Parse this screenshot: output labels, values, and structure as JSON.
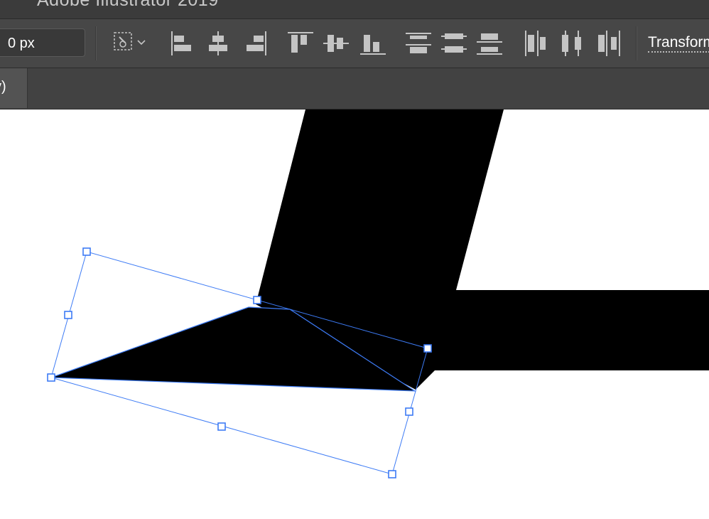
{
  "window": {
    "title": "Adobe Illustrator 2019"
  },
  "control_bar": {
    "stroke_field_value": "0 px",
    "transform_label": "Transform",
    "tools": [
      {
        "name": "select-same-icon"
      },
      {
        "name": "align-left-icon"
      },
      {
        "name": "align-horizontal-center-icon"
      },
      {
        "name": "align-right-icon"
      },
      {
        "name": "align-top-icon"
      },
      {
        "name": "align-vertical-center-icon"
      },
      {
        "name": "align-bottom-icon"
      },
      {
        "name": "distribute-top-icon"
      },
      {
        "name": "distribute-vertical-center-icon"
      },
      {
        "name": "distribute-bottom-icon"
      },
      {
        "name": "distribute-left-icon"
      },
      {
        "name": "distribute-horizontal-center-icon"
      },
      {
        "name": "distribute-right-icon"
      }
    ]
  },
  "document_tab": {
    "label": "v)"
  },
  "colors": {
    "selection": "#3d7bf5",
    "artwork": "#000000",
    "ui_dark": "#474747",
    "ui_icon": "#c4c4c4"
  }
}
